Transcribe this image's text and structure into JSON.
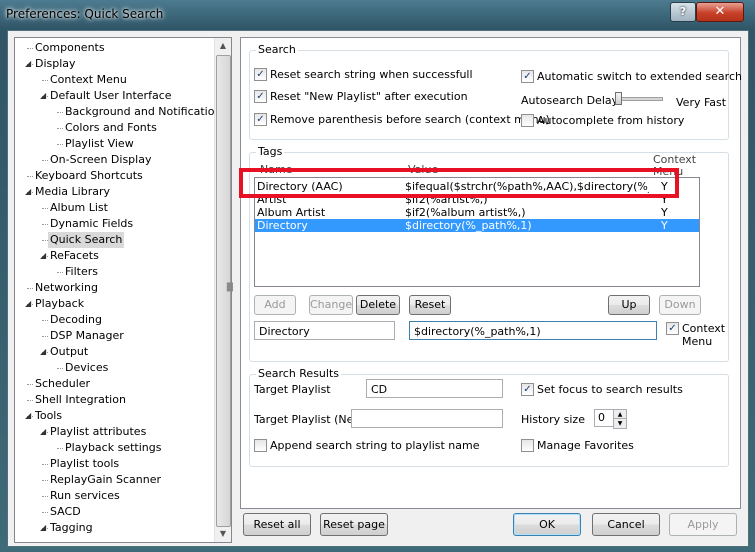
{
  "window": {
    "title": "Preferences: Quick Search",
    "help_label": "?",
    "close_label": "✕"
  },
  "tree": {
    "items": [
      {
        "label": "Components",
        "level": 0,
        "toggle": ""
      },
      {
        "label": "Display",
        "level": 0,
        "toggle": "◢"
      },
      {
        "label": "Context Menu",
        "level": 1,
        "toggle": ""
      },
      {
        "label": "Default User Interface",
        "level": 1,
        "toggle": "◢"
      },
      {
        "label": "Background and Notifications",
        "level": 2,
        "toggle": ""
      },
      {
        "label": "Colors and Fonts",
        "level": 2,
        "toggle": ""
      },
      {
        "label": "Playlist View",
        "level": 2,
        "toggle": ""
      },
      {
        "label": "On-Screen Display",
        "level": 1,
        "toggle": ""
      },
      {
        "label": "Keyboard Shortcuts",
        "level": 0,
        "toggle": ""
      },
      {
        "label": "Media Library",
        "level": 0,
        "toggle": "◢"
      },
      {
        "label": "Album List",
        "level": 1,
        "toggle": ""
      },
      {
        "label": "Dynamic Fields",
        "level": 1,
        "toggle": ""
      },
      {
        "label": "Quick Search",
        "level": 1,
        "toggle": "",
        "selected": true
      },
      {
        "label": "ReFacets",
        "level": 1,
        "toggle": "◢"
      },
      {
        "label": "Filters",
        "level": 2,
        "toggle": ""
      },
      {
        "label": "Networking",
        "level": 0,
        "toggle": ""
      },
      {
        "label": "Playback",
        "level": 0,
        "toggle": "◢"
      },
      {
        "label": "Decoding",
        "level": 1,
        "toggle": ""
      },
      {
        "label": "DSP Manager",
        "level": 1,
        "toggle": ""
      },
      {
        "label": "Output",
        "level": 1,
        "toggle": "◢"
      },
      {
        "label": "Devices",
        "level": 2,
        "toggle": ""
      },
      {
        "label": "Scheduler",
        "level": 0,
        "toggle": ""
      },
      {
        "label": "Shell Integration",
        "level": 0,
        "toggle": ""
      },
      {
        "label": "Tools",
        "level": 0,
        "toggle": "◢"
      },
      {
        "label": "Playlist attributes",
        "level": 1,
        "toggle": "◢"
      },
      {
        "label": "Playback settings",
        "level": 2,
        "toggle": ""
      },
      {
        "label": "Playlist tools",
        "level": 1,
        "toggle": ""
      },
      {
        "label": "ReplayGain Scanner",
        "level": 1,
        "toggle": ""
      },
      {
        "label": "Run services",
        "level": 1,
        "toggle": ""
      },
      {
        "label": "SACD",
        "level": 1,
        "toggle": ""
      },
      {
        "label": "Tagging",
        "level": 1,
        "toggle": "◢"
      }
    ]
  },
  "search": {
    "group_title": "Search",
    "reset_string": {
      "label": "Reset search string when successfull",
      "checked": true
    },
    "reset_playlist": {
      "label": "Reset \"New Playlist\" after execution",
      "checked": true
    },
    "remove_paren": {
      "label": "Remove parenthesis before search (context menu)",
      "checked": true
    },
    "auto_switch": {
      "label": "Automatic switch to extended search",
      "checked": true
    },
    "autosearch_delay_label": "Autosearch Delay",
    "autosearch_delay_value_label": "Very Fast",
    "autocomplete": {
      "label": "Autocomplete from history",
      "checked": false
    }
  },
  "tags": {
    "group_title": "Tags",
    "columns": {
      "name": "Name",
      "value": "Value",
      "context": "Context Menu"
    },
    "rows": [
      {
        "name": "Directory (AAC)",
        "value": "$ifequal($strchr(%path%,AAC),$directory(%_...",
        "context": "Y",
        "selected": false
      },
      {
        "name": "Artist",
        "value": "$if2(%artist%,)",
        "context": "Y",
        "selected": false
      },
      {
        "name": "Album Artist",
        "value": "$if2(%album artist%,)",
        "context": "Y",
        "selected": false
      },
      {
        "name": "Directory",
        "value": "$directory(%_path%,1)",
        "context": "Y",
        "selected": true
      }
    ],
    "buttons": {
      "add": "Add",
      "change": "Change",
      "delete": "Delete",
      "reset": "Reset",
      "up": "Up",
      "down": "Down"
    },
    "edit_name": "Directory",
    "edit_value": "$directory(%_path%,1)",
    "context_menu_checkbox": {
      "label": "Context Menu",
      "checked": true
    }
  },
  "results": {
    "group_title": "Search Results",
    "target_playlist_label": "Target Playlist",
    "target_playlist_value": "CD",
    "target_playlist_new_label": "Target Playlist (New)",
    "target_playlist_new_value": "",
    "set_focus": {
      "label": "Set focus to search results",
      "checked": true
    },
    "history_size_label": "History size",
    "history_size_value": "0",
    "append_string": {
      "label": "Append search string to playlist name",
      "checked": false
    },
    "manage_favorites": {
      "label": "Manage Favorites",
      "checked": false
    }
  },
  "footer": {
    "reset_all": "Reset all",
    "reset_page": "Reset page",
    "ok": "OK",
    "cancel": "Cancel",
    "apply": "Apply"
  },
  "colors": {
    "highlight": "#3399ff",
    "annotation_red": "#e81123"
  }
}
